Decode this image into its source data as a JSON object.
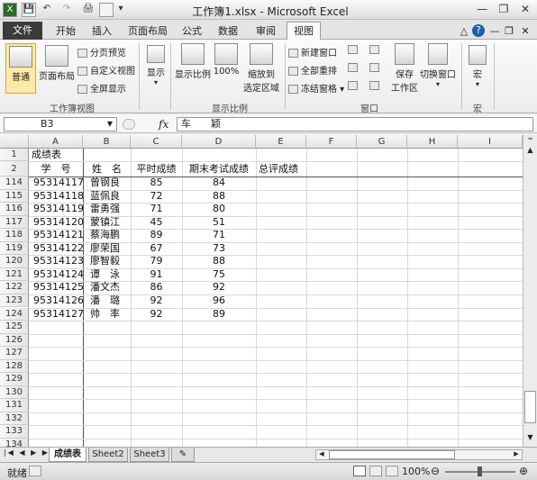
{
  "titlebar": {
    "title": "工作簿1.xlsx - Microsoft Excel",
    "qat": [
      "X",
      "💾",
      "↶",
      "↷",
      "🖨",
      "▾"
    ],
    "window_controls": [
      "—",
      "❐",
      "✕"
    ]
  },
  "tabs": {
    "file": "文件",
    "items": [
      "开始",
      "插入",
      "页面布局",
      "公式",
      "数据",
      "审阅",
      "视图"
    ],
    "active": "视图",
    "right_icons": [
      "△",
      "?",
      "—",
      "❐",
      "✕"
    ]
  },
  "ribbon": {
    "group_workbook_views": {
      "label": "工作簿视图",
      "normal": "普通",
      "page_layout": "页面布局",
      "page_break": "分页预览",
      "custom_views": "自定义视图",
      "fullscreen": "全屏显示"
    },
    "group_show": {
      "show": "显示"
    },
    "group_zoom": {
      "label": "显示比例",
      "zoom": "显示比例",
      "hundred": "100%",
      "zoom_to_selection_1": "缩放到",
      "zoom_to_selection_2": "选定区域"
    },
    "group_window": {
      "label": "窗口",
      "new_window": "新建窗口",
      "arrange_all": "全部重排",
      "freeze_panes": "冻结窗格",
      "save_workspace_1": "保存",
      "save_workspace_2": "工作区",
      "switch_windows": "切换窗口"
    },
    "group_macros": {
      "label": "宏",
      "macros": "宏"
    }
  },
  "formula_bar": {
    "name_box": "B3",
    "fx": "fx",
    "content": "车　　颖"
  },
  "grid": {
    "columns": [
      "A",
      "B",
      "C",
      "D",
      "E",
      "F",
      "G",
      "H",
      "I"
    ],
    "title_cell": "成绩表",
    "headers": [
      "学　号",
      "姓　名",
      "平时成绩",
      "期末考试成绩",
      "总评成绩"
    ],
    "header_rows": [
      "1",
      "2"
    ],
    "rows": [
      {
        "n": "114",
        "id": "95314117",
        "name": "曾钢良",
        "usual": "85",
        "final": "84"
      },
      {
        "n": "115",
        "id": "95314118",
        "name": "蓝佩良",
        "usual": "72",
        "final": "88"
      },
      {
        "n": "116",
        "id": "95314119",
        "name": "雷勇强",
        "usual": "71",
        "final": "80"
      },
      {
        "n": "117",
        "id": "95314120",
        "name": "蒙镇江",
        "usual": "45",
        "final": "51"
      },
      {
        "n": "118",
        "id": "95314121",
        "name": "蔡海鹏",
        "usual": "89",
        "final": "71"
      },
      {
        "n": "119",
        "id": "95314122",
        "name": "廖荣国",
        "usual": "67",
        "final": "73"
      },
      {
        "n": "120",
        "id": "95314123",
        "name": "廖智毅",
        "usual": "79",
        "final": "88"
      },
      {
        "n": "121",
        "id": "95314124",
        "name": "谭　泳",
        "usual": "91",
        "final": "75"
      },
      {
        "n": "122",
        "id": "95314125",
        "name": "潘文杰",
        "usual": "86",
        "final": "92"
      },
      {
        "n": "123",
        "id": "95314126",
        "name": "潘　璐",
        "usual": "92",
        "final": "96"
      },
      {
        "n": "124",
        "id": "95314127",
        "name": "帅　率",
        "usual": "92",
        "final": "89"
      }
    ],
    "empty_rows": [
      "125",
      "126",
      "127",
      "128",
      "129",
      "130",
      "131",
      "132",
      "133",
      "134"
    ]
  },
  "sheets": {
    "tabs": [
      "成绩表",
      "Sheet2",
      "Sheet3"
    ],
    "active": "成绩表"
  },
  "statusbar": {
    "ready": "就绪",
    "zoom": "100%"
  }
}
